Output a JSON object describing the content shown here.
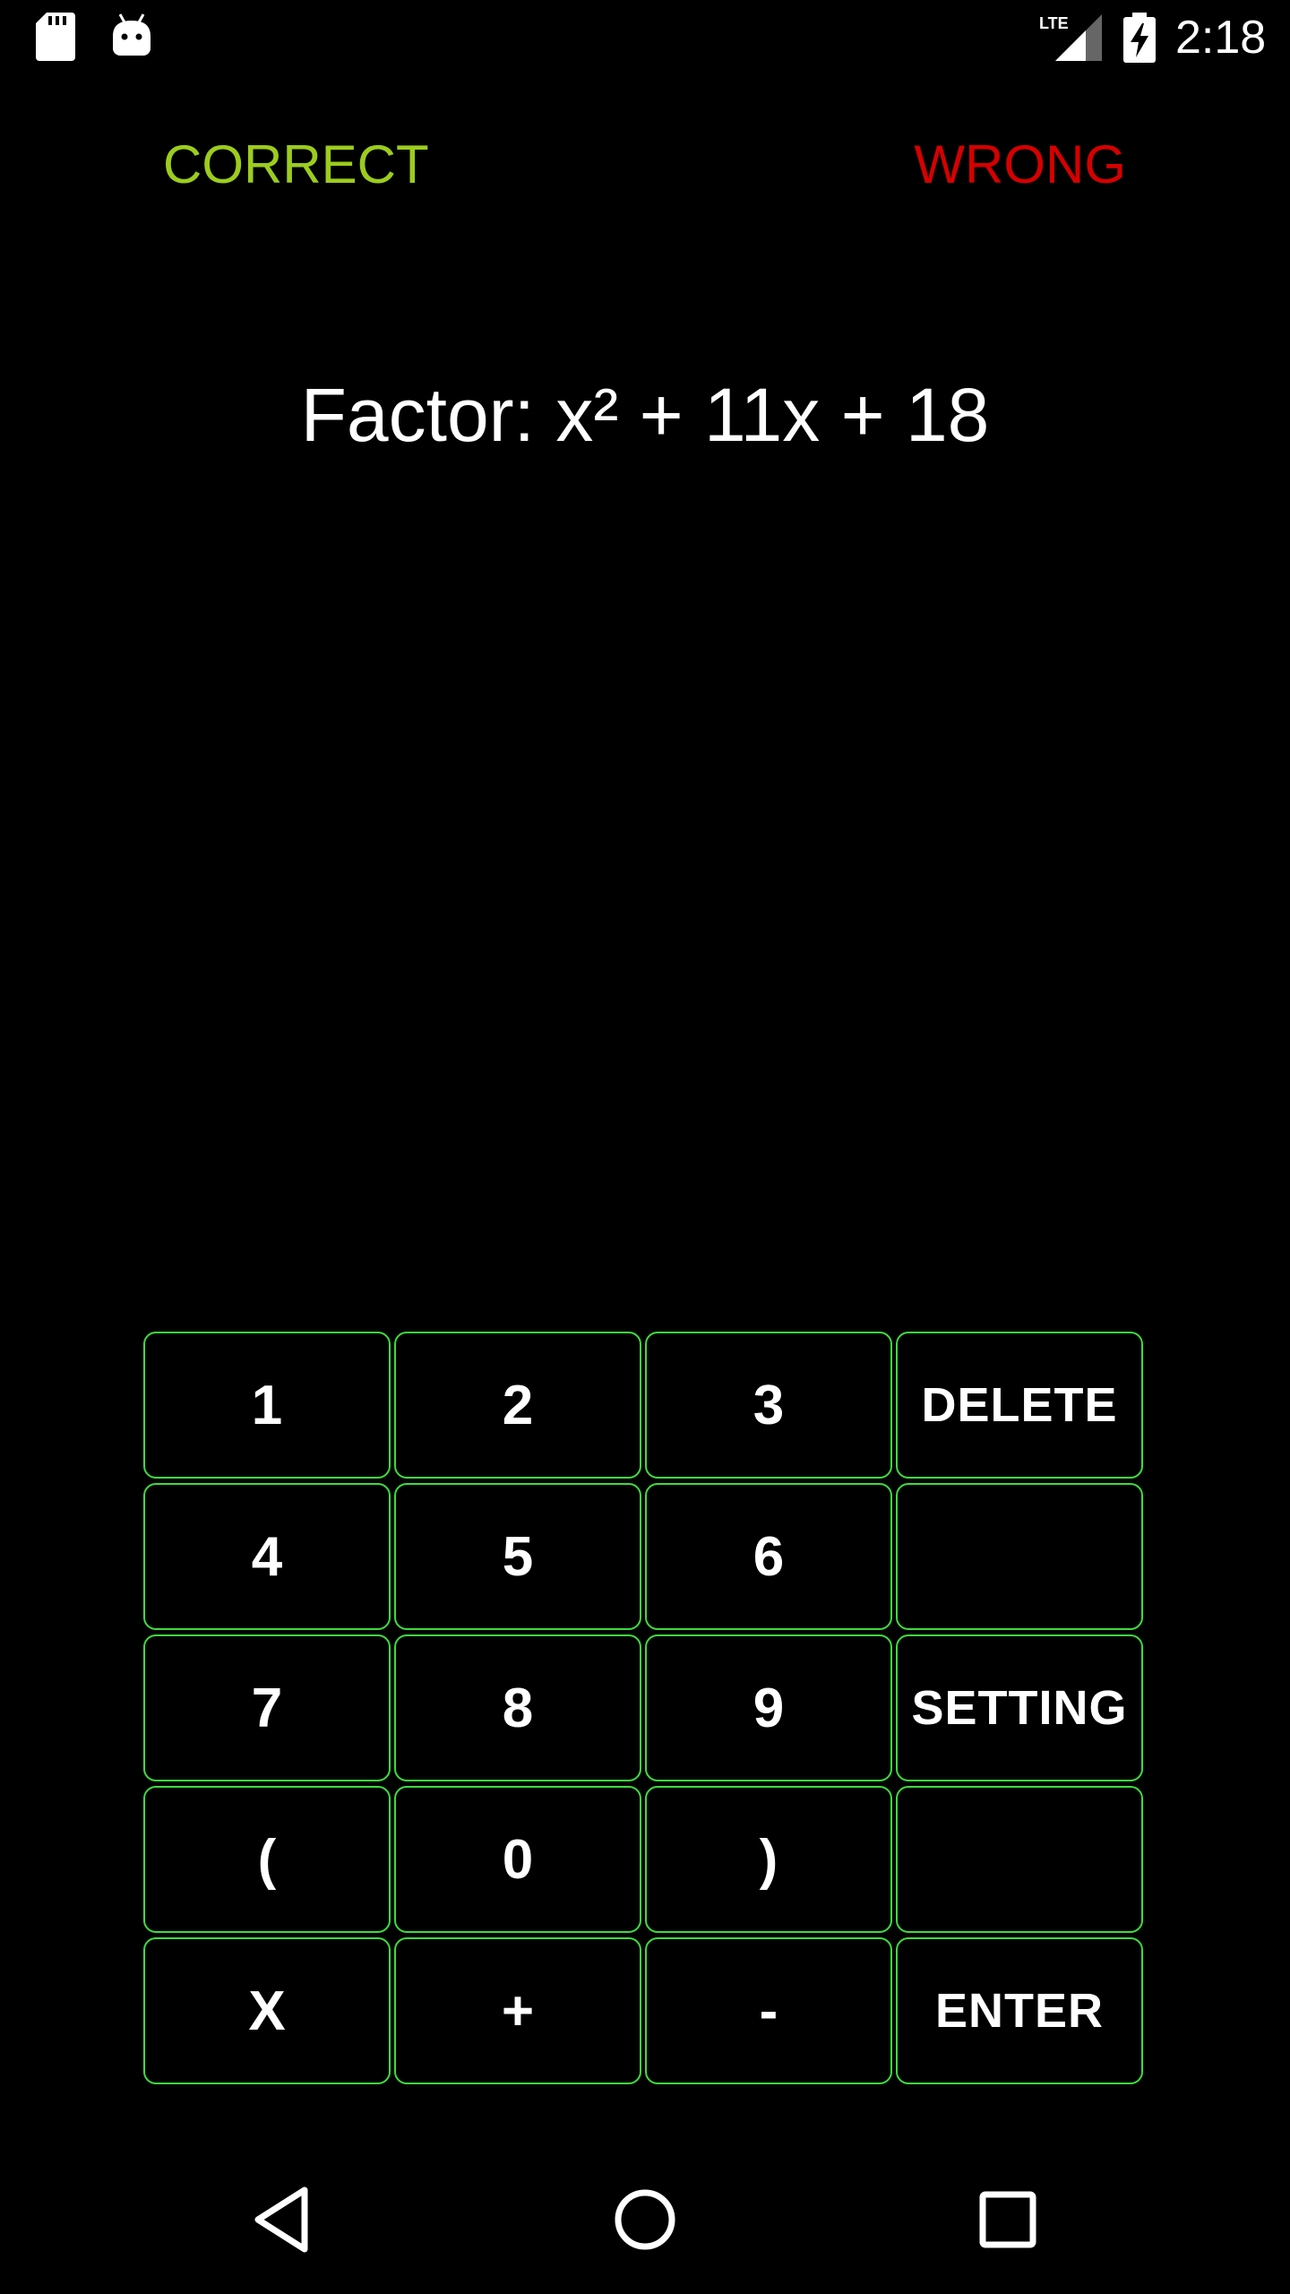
{
  "status_bar": {
    "time": "2:18",
    "network": "LTE",
    "icons": [
      "sd-card-icon",
      "android-icon",
      "lte-signal-icon",
      "battery-charging-icon"
    ]
  },
  "score": {
    "correct_label": "CORRECT",
    "wrong_label": "WRONG",
    "correct_color": "#9ccc1e",
    "wrong_color": "#d50000"
  },
  "problem": {
    "text": "Factor: x² + 11x + 18"
  },
  "keypad": {
    "border_color": "#3ddc3d",
    "keys": [
      {
        "label": "1",
        "name": "key-1"
      },
      {
        "label": "2",
        "name": "key-2"
      },
      {
        "label": "3",
        "name": "key-3"
      },
      {
        "label": "DELETE",
        "name": "delete-button"
      },
      {
        "label": "4",
        "name": "key-4"
      },
      {
        "label": "5",
        "name": "key-5"
      },
      {
        "label": "6",
        "name": "key-6"
      },
      {
        "label": "",
        "name": "blank-key-1"
      },
      {
        "label": "7",
        "name": "key-7"
      },
      {
        "label": "8",
        "name": "key-8"
      },
      {
        "label": "9",
        "name": "key-9"
      },
      {
        "label": "SETTING",
        "name": "setting-button"
      },
      {
        "label": "(",
        "name": "key-open-paren"
      },
      {
        "label": "0",
        "name": "key-0"
      },
      {
        "label": ")",
        "name": "key-close-paren"
      },
      {
        "label": "",
        "name": "blank-key-2"
      },
      {
        "label": "X",
        "name": "key-x"
      },
      {
        "label": "+",
        "name": "key-plus"
      },
      {
        "label": "-",
        "name": "key-minus"
      },
      {
        "label": "ENTER",
        "name": "enter-button"
      }
    ]
  },
  "nav_bar": {
    "icons": [
      "back-icon",
      "home-icon",
      "recent-apps-icon"
    ]
  }
}
